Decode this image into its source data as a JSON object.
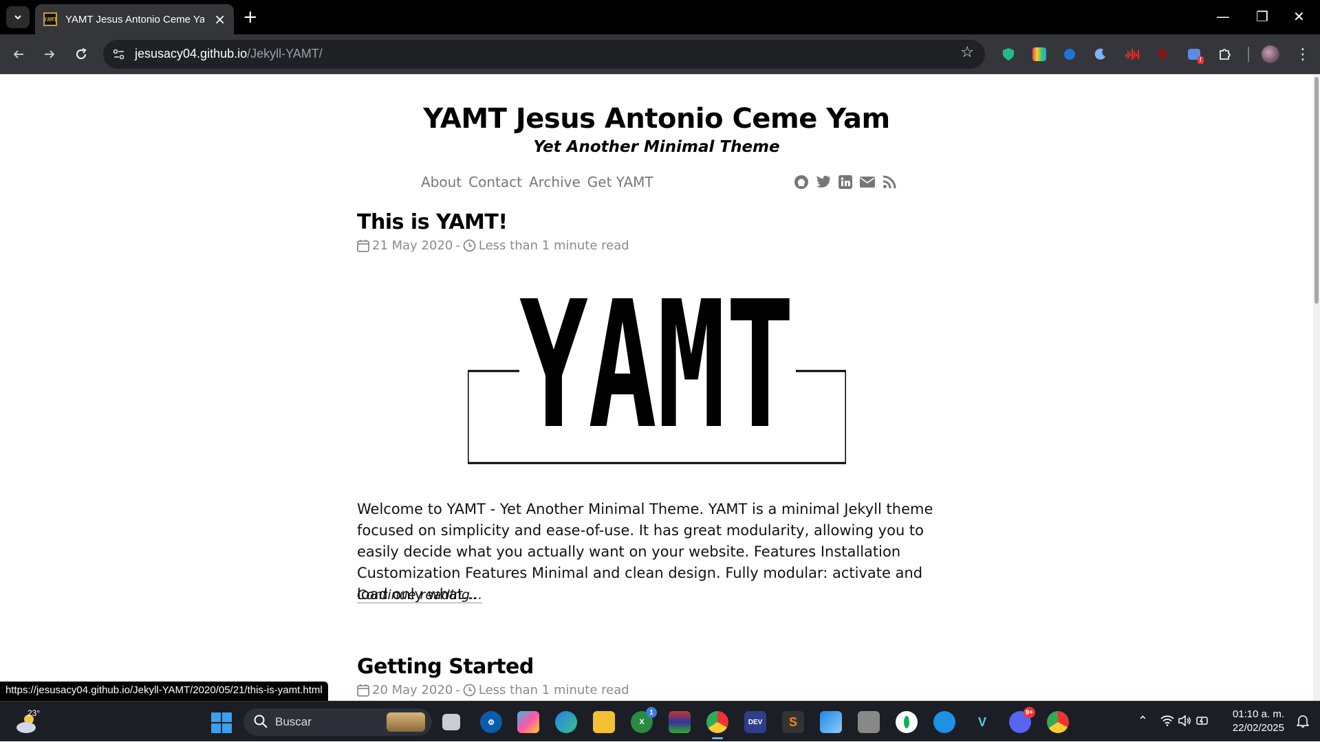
{
  "browser": {
    "tab_title": "YAMT Jesus Antonio Ceme Yam",
    "favicon_text": "YAMT",
    "url_host": "jesusacy04.github.io",
    "url_path": "/Jekyll-YAMT/",
    "status_url": "https://jesusacy04.github.io/Jekyll-YAMT/2020/05/21/this-is-yamt.html"
  },
  "site": {
    "title": "YAMT Jesus Antonio Ceme Yam",
    "subtitle": "Yet Another Minimal Theme",
    "menu": [
      "About",
      "Contact",
      "Archive",
      "Get YAMT"
    ],
    "social_icons": [
      "github-icon",
      "twitter-icon",
      "linkedin-icon",
      "email-icon",
      "rss-icon"
    ]
  },
  "posts": [
    {
      "title": "This is YAMT!",
      "date": "21 May 2020",
      "separator": "-",
      "read_time": "Less than 1 minute read",
      "logo_text": "YAMT",
      "excerpt": "Welcome to YAMT - Yet Another Minimal Theme. YAMT is a minimal Jekyll theme focused on simplicity and ease-of-use. It has great modularity, allowing you to easily decide what you actually want on your website. Features Installation Customization Features Minimal and clean design. Fully modular: activate and load only what...",
      "continue": "Continue reading..."
    },
    {
      "title": "Getting Started",
      "date": "20 May 2020",
      "separator": "-",
      "read_time": "Less than 1 minute read"
    }
  ],
  "taskbar": {
    "weather_temp": "23°",
    "search_placeholder": "Buscar",
    "time": "01:10 a. m.",
    "date": "22/02/2025",
    "discord_badge": "9+",
    "xbox_badge": "1"
  }
}
